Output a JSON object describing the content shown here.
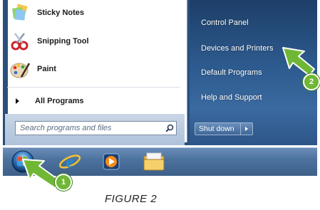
{
  "start_menu": {
    "programs": [
      {
        "label": "Sticky Notes",
        "icon": "sticky-notes-icon"
      },
      {
        "label": "Snipping Tool",
        "icon": "snipping-tool-icon"
      },
      {
        "label": "Paint",
        "icon": "paint-icon"
      }
    ],
    "all_programs_label": "All Programs",
    "search_placeholder": "Search programs and files",
    "right_links": [
      {
        "label": "Control Panel"
      },
      {
        "label": "Devices and Printers"
      },
      {
        "label": "Default Programs"
      },
      {
        "label": "Help and Support"
      }
    ],
    "shutdown_label": "Shut down"
  },
  "taskbar": {
    "items": [
      "start-orb-icon",
      "internet-explorer-icon",
      "media-player-icon",
      "folder-icon"
    ]
  },
  "callouts": {
    "badge_1": "1",
    "badge_2": "2"
  },
  "caption": "FIGURE 2",
  "colors": {
    "callout_green": "#6fb735",
    "menu_right_pane": "#2d5a8e",
    "taskbar": "#4c739f"
  }
}
